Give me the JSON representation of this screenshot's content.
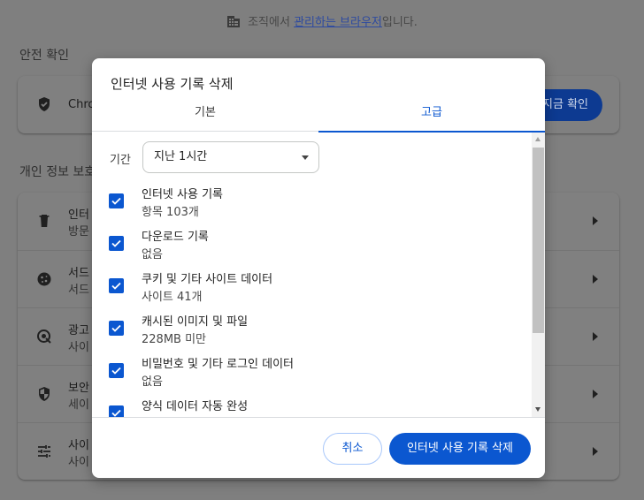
{
  "banner": {
    "prefix": "조직에서 ",
    "link": "관리하는 브라우저",
    "suffix": "입니다."
  },
  "safety_check": {
    "section_title": "안전 확인",
    "row_text": "Chro",
    "button_label": "지금 확인"
  },
  "privacy": {
    "section_title": "개인 정보 보호",
    "rows": [
      {
        "icon": "trash-icon",
        "title": "인터",
        "subtitle": "방문"
      },
      {
        "icon": "cookie-icon",
        "title": "서드",
        "subtitle": "서드"
      },
      {
        "icon": "ad-privacy-icon",
        "title": "광고",
        "subtitle": "사이"
      },
      {
        "icon": "security-shield-icon",
        "title": "보안",
        "subtitle": "세이"
      },
      {
        "icon": "tune-icon",
        "title": "사이",
        "subtitle": "사이"
      }
    ]
  },
  "dialog": {
    "title": "인터넷 사용 기록 삭제",
    "tabs": [
      {
        "label": "기본",
        "active": false
      },
      {
        "label": "고급",
        "active": true
      }
    ],
    "time_range_label": "기간",
    "time_range_value": "지난 1시간",
    "items": [
      {
        "label": "인터넷 사용 기록",
        "detail": "항목 103개",
        "checked": true
      },
      {
        "label": "다운로드 기록",
        "detail": "없음",
        "checked": true
      },
      {
        "label": "쿠키 및 기타 사이트 데이터",
        "detail": "사이트 41개",
        "checked": true
      },
      {
        "label": "캐시된 이미지 및 파일",
        "detail": "228MB 미만",
        "checked": true
      },
      {
        "label": "비밀번호 및 기타 로그인 데이터",
        "detail": "없음",
        "checked": true
      },
      {
        "label": "양식 데이터 자동 완성",
        "detail": "",
        "checked": true
      }
    ],
    "cancel_label": "취소",
    "confirm_label": "인터넷 사용 기록 삭제"
  },
  "colors": {
    "accent": "#0b57d0",
    "scrim": "#7f7f7f"
  }
}
